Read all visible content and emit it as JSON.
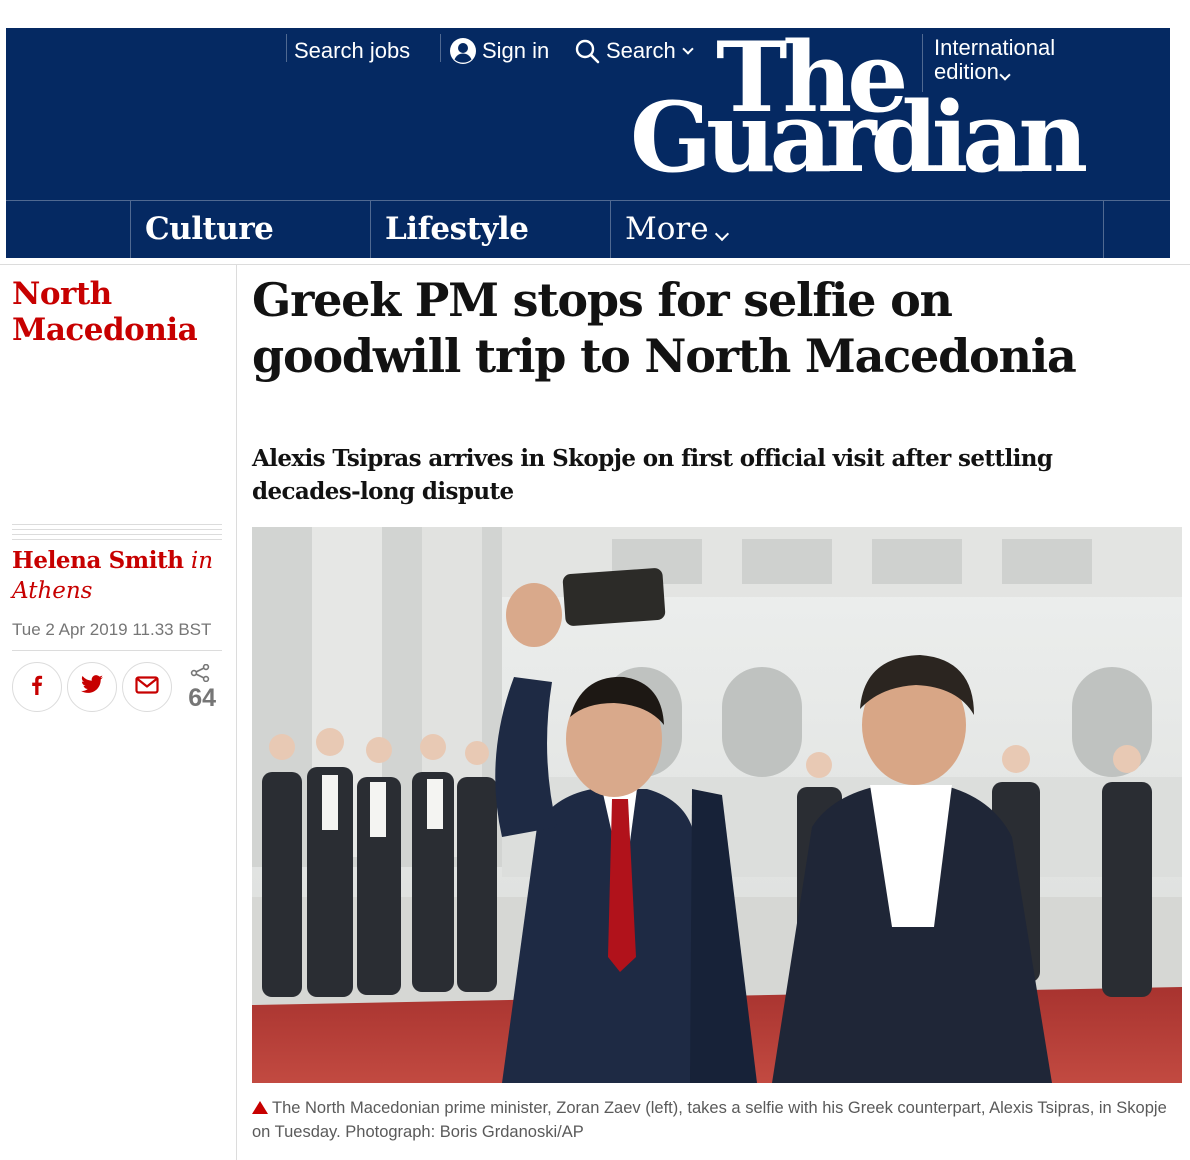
{
  "header": {
    "search_jobs": "Search jobs",
    "sign_in": "Sign in",
    "search": "Search",
    "logo_line1": "The",
    "logo_line2": "Guardian",
    "edition_line1": "International",
    "edition_line2": "edition",
    "nav": {
      "culture": "Culture",
      "lifestyle": "Lifestyle",
      "more": "More"
    }
  },
  "article": {
    "section": "North Macedonia",
    "headline": "Greek PM stops for selfie on goodwill trip to North Macedonia",
    "standfirst": "Alexis Tsipras arrives in Skopje on first official visit after settling decades-long dispute",
    "author": "Helena Smith",
    "byline_in": "in",
    "location": "Athens",
    "date": "Tue 2 Apr 2019 11.33 BST",
    "share_count": "64",
    "caption": "The North Macedonian prime minister, Zoran Zaev (left), takes a selfie with his Greek counterpart, Alexis Tsipras, in Skopje on Tuesday. Photograph: Boris Grdanoski/AP"
  },
  "colors": {
    "brand_navy": "#052962",
    "news_red": "#c70000",
    "text": "#121212",
    "meta_grey": "#767676"
  },
  "icons": {
    "sign_in": "user-circle-icon",
    "search": "magnifier-icon",
    "dropdown": "chevron-down-icon",
    "share_facebook": "facebook-icon",
    "share_twitter": "twitter-icon",
    "share_email": "email-icon",
    "share": "share-icon",
    "caption": "triangle-up-icon"
  }
}
